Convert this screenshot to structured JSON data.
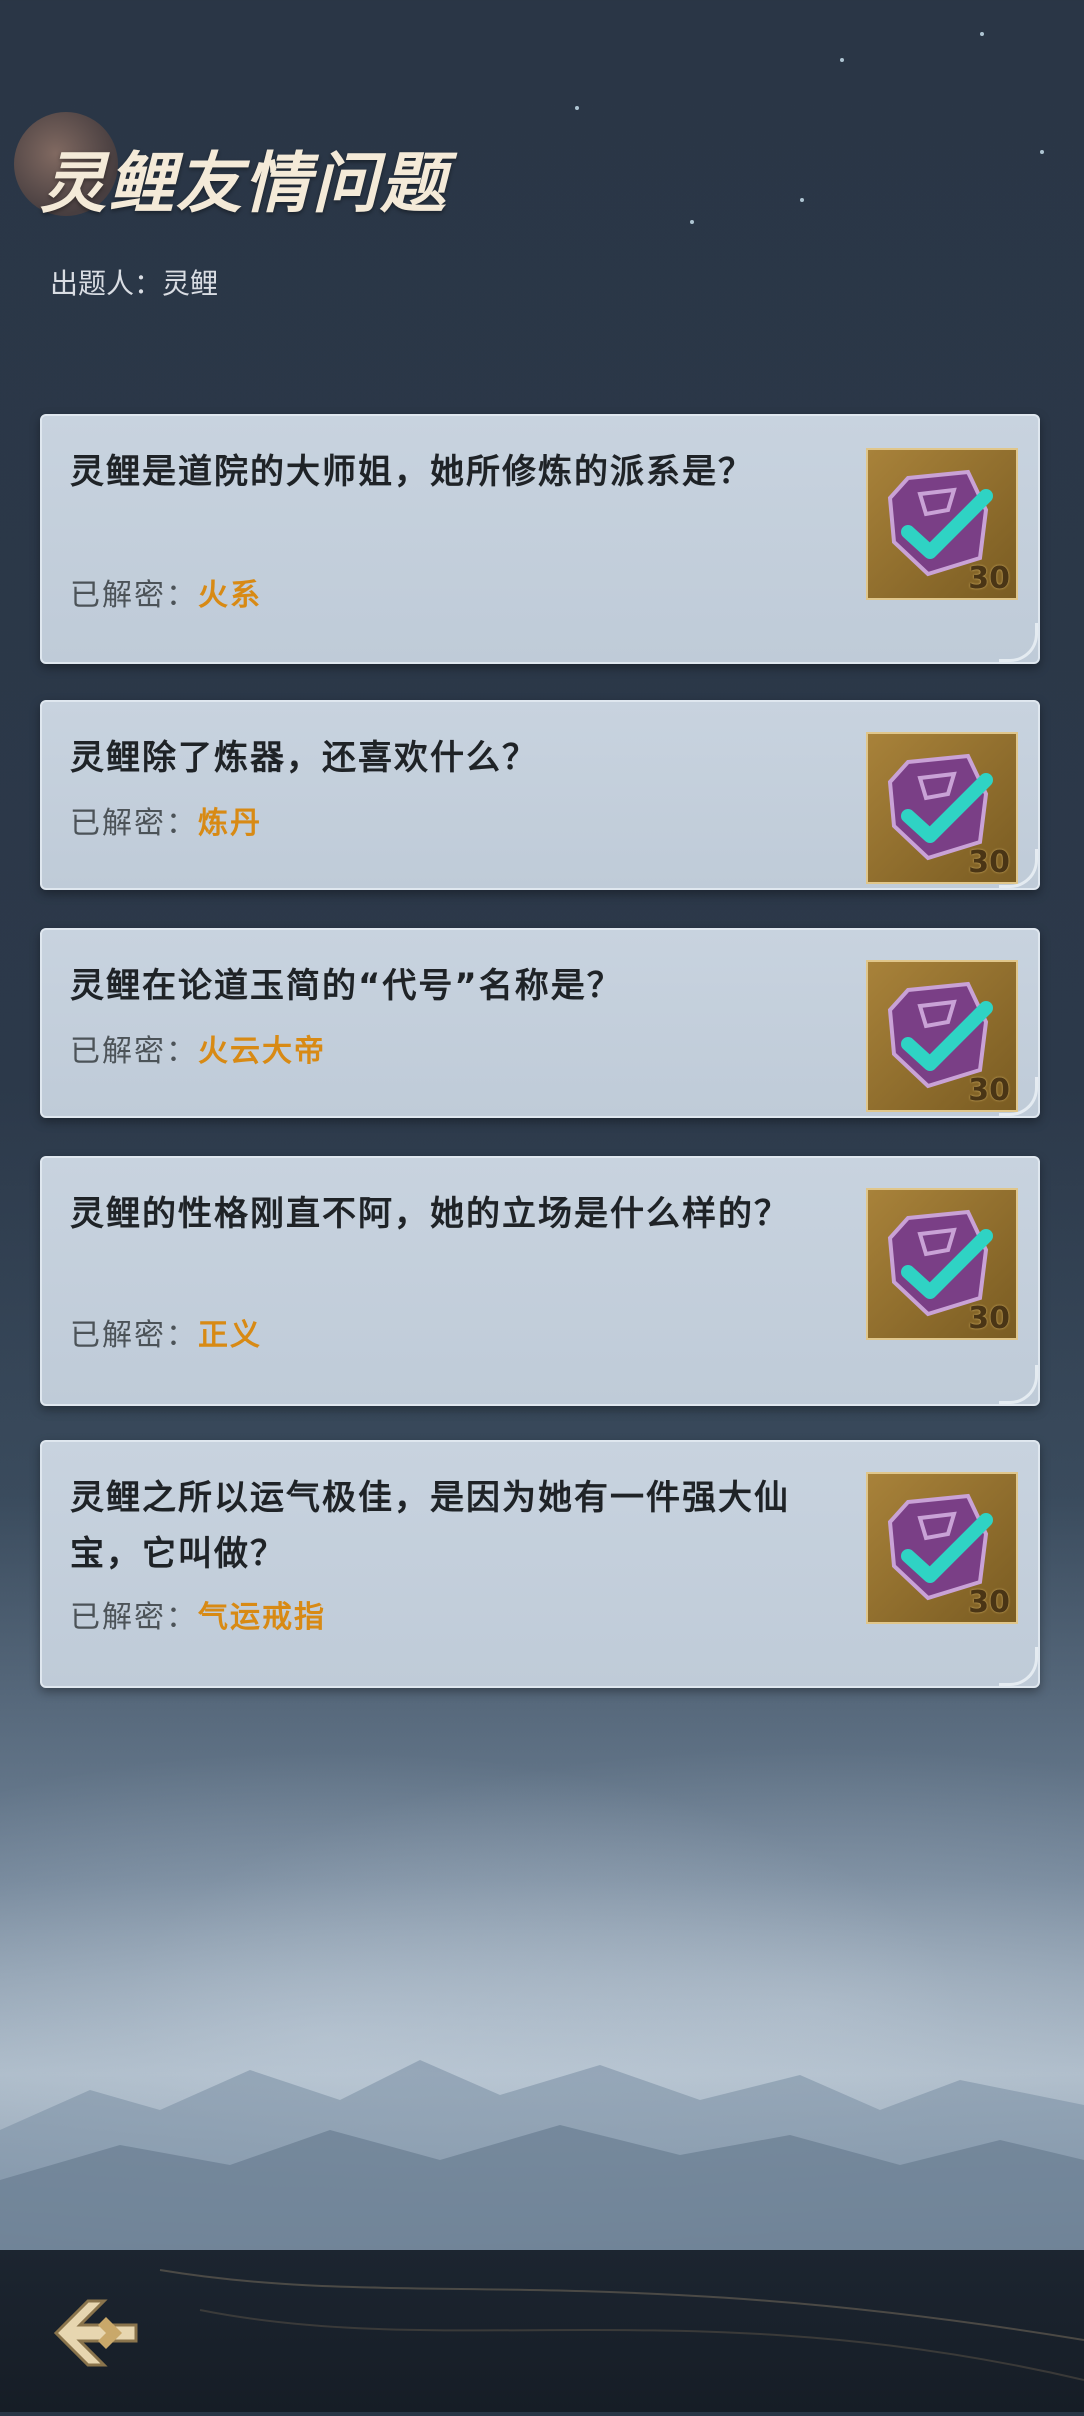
{
  "header": {
    "title": "灵鲤友情问题",
    "author_label": "出题人：",
    "author_name": "灵鲤"
  },
  "answer_label": "已解密：",
  "questions": [
    {
      "text": "灵鲤是道院的大师姐，她所修炼的派系是？",
      "answer": "火系",
      "reward": "30"
    },
    {
      "text": "灵鲤除了炼器，还喜欢什么？",
      "answer": "炼丹",
      "reward": "30"
    },
    {
      "text": "灵鲤在论道玉简的“代号”名称是？",
      "answer": "火云大帝",
      "reward": "30"
    },
    {
      "text": "灵鲤的性格刚直不阿，她的立场是什么样的？",
      "answer": "正义",
      "reward": "30"
    },
    {
      "text": "灵鲤之所以运气极佳，是因为她有一件强大仙宝，它叫做？",
      "answer": "气运戒指",
      "reward": "30"
    }
  ],
  "icons": {
    "badge": "purple-rune-check-icon",
    "back": "back-arrow-icon"
  },
  "colors": {
    "answer": "#d88a14",
    "check": "#2fd3c4",
    "rune": "#7a3f86"
  }
}
